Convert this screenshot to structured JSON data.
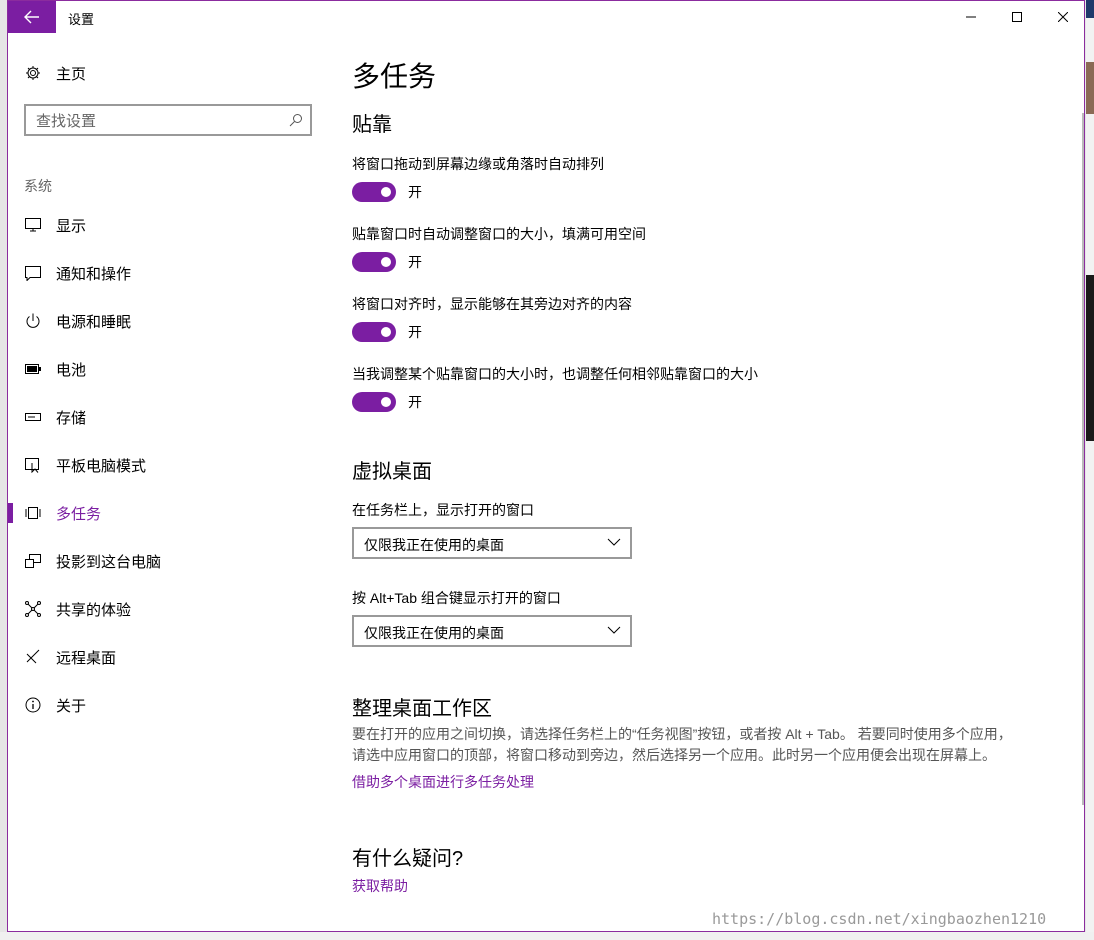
{
  "window": {
    "title": "设置",
    "accent_color": "#7b1ea2"
  },
  "sidebar": {
    "home_label": "主页",
    "search_placeholder": "查找设置",
    "section": "系统",
    "items": [
      {
        "label": "显示",
        "icon": "monitor-icon"
      },
      {
        "label": "通知和操作",
        "icon": "notification-icon"
      },
      {
        "label": "电源和睡眠",
        "icon": "power-icon"
      },
      {
        "label": "电池",
        "icon": "battery-icon"
      },
      {
        "label": "存储",
        "icon": "storage-icon"
      },
      {
        "label": "平板电脑模式",
        "icon": "tablet-mode-icon"
      },
      {
        "label": "多任务",
        "icon": "multitasking-icon",
        "active": true
      },
      {
        "label": "投影到这台电脑",
        "icon": "project-icon"
      },
      {
        "label": "共享的体验",
        "icon": "shared-experiences-icon"
      },
      {
        "label": "远程桌面",
        "icon": "remote-desktop-icon"
      },
      {
        "label": "关于",
        "icon": "info-icon"
      }
    ]
  },
  "main": {
    "title": "多任务",
    "snap": {
      "heading": "贴靠",
      "options": [
        {
          "label": "将窗口拖动到屏幕边缘或角落时自动排列",
          "state": "开"
        },
        {
          "label": "贴靠窗口时自动调整窗口的大小，填满可用空间",
          "state": "开"
        },
        {
          "label": "将窗口对齐时，显示能够在其旁边对齐的内容",
          "state": "开"
        },
        {
          "label": "当我调整某个贴靠窗口的大小时，也调整任何相邻贴靠窗口的大小",
          "state": "开"
        }
      ]
    },
    "virtual_desktops": {
      "heading": "虚拟桌面",
      "taskbar_label": "在任务栏上，显示打开的窗口",
      "taskbar_value": "仅限我正在使用的桌面",
      "alttab_label": "按 Alt+Tab 组合键显示打开的窗口",
      "alttab_value": "仅限我正在使用的桌面"
    },
    "organize": {
      "heading": "整理桌面工作区",
      "desc_line1": "要在打开的应用之间切换，请选择任务栏上的“任务视图”按钮，或者按 Alt + Tab。 若要同时使用多个应用，",
      "desc_line2": "请选中应用窗口的顶部，将窗口移动到旁边，然后选择另一个应用。此时另一个应用便会出现在屏幕上。",
      "link": "借助多个桌面进行多任务处理"
    },
    "help": {
      "heading": "有什么疑问?",
      "link": "获取帮助"
    }
  },
  "watermark": "https://blog.csdn.net/xingbaozhen1210"
}
